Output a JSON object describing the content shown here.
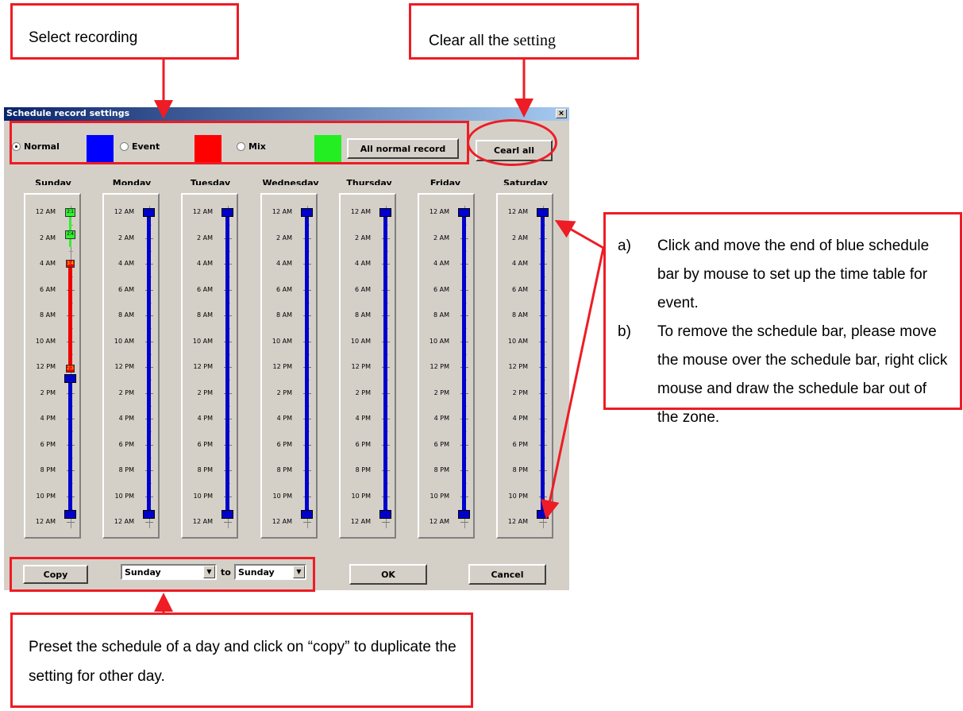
{
  "annotations": {
    "select_recording": "Select recording",
    "clear_all_a": "Clear all the ",
    "clear_all_b": "setting",
    "side_notes": [
      {
        "marker": "a)",
        "text": "Click and move the end of blue schedule bar by mouse to set up the time table for event."
      },
      {
        "marker": "b)",
        "text": "To remove the schedule bar, please move the mouse over the schedule bar, right click mouse and draw the schedule bar out of the zone."
      }
    ],
    "bottom_note": "Preset the schedule of a day and click on “copy” to duplicate the setting for other day."
  },
  "window": {
    "title": "Schedule record settings",
    "close_glyph": "×",
    "modes": [
      {
        "label": "Normal",
        "selected": true,
        "color": "#0000ff"
      },
      {
        "label": "Event",
        "selected": false,
        "color": "#ff0000"
      },
      {
        "label": "Mix",
        "selected": false,
        "color": "#00ff00"
      }
    ],
    "all_normal_button": "All normal record",
    "clear_all_button": "Cearl all",
    "days": [
      "Sunday",
      "Monday",
      "Tuesday",
      "Wednesday",
      "Thursday",
      "Friday",
      "Saturday"
    ],
    "time_labels": [
      "12 AM",
      "2 AM",
      "4 AM",
      "6 AM",
      "8 AM",
      "10 AM",
      "12 PM",
      "2 PM",
      "4 PM",
      "6 PM",
      "8 PM",
      "10 PM",
      "12 AM"
    ],
    "sunday_segments": {
      "green_marks": [
        "2:1",
        "2:4"
      ],
      "red_marks": [
        "3:4",
        "2:3"
      ]
    },
    "copy_button": "Copy",
    "copy_from": "Sunday",
    "copy_to_label": "to",
    "copy_to": "Sunday",
    "dropdown_arrow": "▼",
    "ok_button": "OK",
    "cancel_button": "Cancel"
  }
}
